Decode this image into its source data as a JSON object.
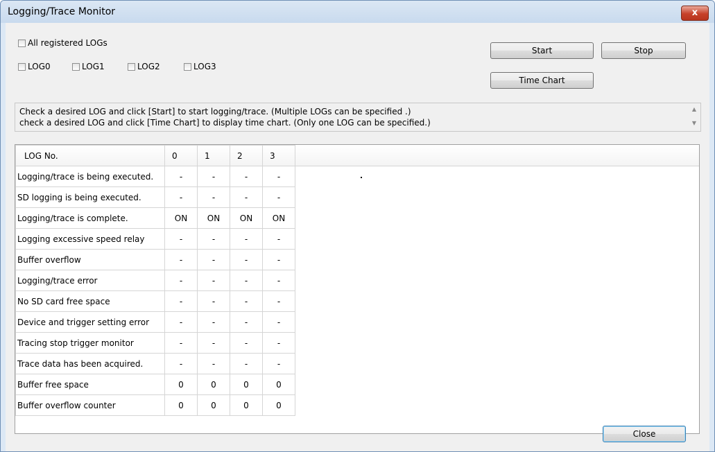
{
  "window": {
    "title": "Logging/Trace Monitor",
    "close_glyph": "x"
  },
  "selection": {
    "all_registered": "All registered LOGs",
    "logs": [
      "LOG0",
      "LOG1",
      "LOG2",
      "LOG3"
    ]
  },
  "buttons": {
    "start": "Start",
    "stop": "Stop",
    "time_chart": "Time Chart",
    "close": "Close"
  },
  "info": {
    "line1": "Check a desired LOG and click [Start] to start logging/trace. (Multiple LOGs can be specified .)",
    "line2": "check a desired LOG and click [Time Chart] to display time chart. (Only one LOG can be specified.)"
  },
  "table": {
    "header_label": "LOG No.",
    "columns": [
      "0",
      "1",
      "2",
      "3"
    ],
    "rows": [
      {
        "label": "Logging/trace is being executed.",
        "values": [
          "-",
          "-",
          "-",
          "-"
        ]
      },
      {
        "label": "SD logging is being executed.",
        "values": [
          "-",
          "-",
          "-",
          "-"
        ]
      },
      {
        "label": "Logging/trace is complete.",
        "values": [
          "ON",
          "ON",
          "ON",
          "ON"
        ]
      },
      {
        "label": "Logging excessive speed relay",
        "values": [
          "-",
          "-",
          "-",
          "-"
        ]
      },
      {
        "label": "Buffer overflow",
        "values": [
          "-",
          "-",
          "-",
          "-"
        ]
      },
      {
        "label": "Logging/trace error",
        "values": [
          "-",
          "-",
          "-",
          "-"
        ]
      },
      {
        "label": "No SD card free space",
        "values": [
          "-",
          "-",
          "-",
          "-"
        ]
      },
      {
        "label": "Device and trigger setting error",
        "values": [
          "-",
          "-",
          "-",
          "-"
        ]
      },
      {
        "label": "Tracing stop trigger monitor",
        "values": [
          "-",
          "-",
          "-",
          "-"
        ]
      },
      {
        "label": "Trace data has been acquired.",
        "values": [
          "-",
          "-",
          "-",
          "-"
        ]
      },
      {
        "label": "Buffer free space",
        "values": [
          "0",
          "0",
          "0",
          "0"
        ]
      },
      {
        "label": "Buffer overflow counter",
        "values": [
          "0",
          "0",
          "0",
          "0"
        ]
      }
    ]
  }
}
